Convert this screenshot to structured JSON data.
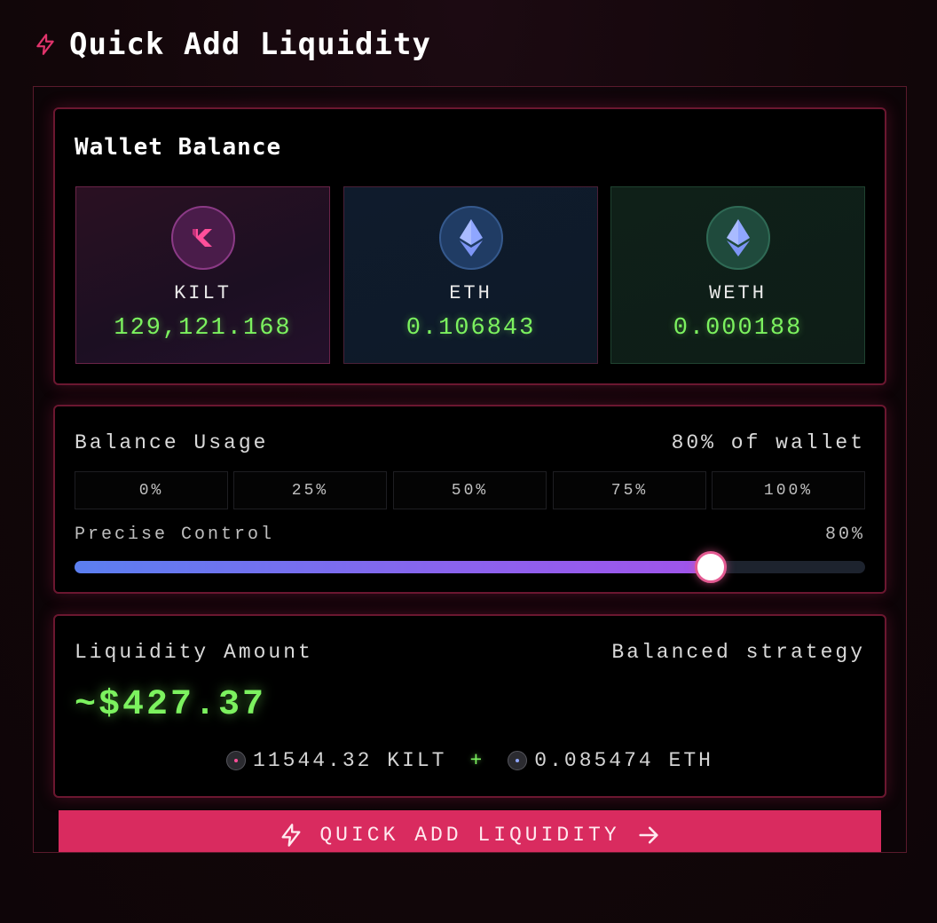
{
  "header": {
    "title": "Quick Add Liquidity",
    "icon": "lightning-icon"
  },
  "wallet": {
    "title": "Wallet Balance",
    "tokens": [
      {
        "symbol": "KILT",
        "balance": "129,121.168",
        "icon": "kilt-logo-icon"
      },
      {
        "symbol": "ETH",
        "balance": "0.106843",
        "icon": "ethereum-icon"
      },
      {
        "symbol": "WETH",
        "balance": "0.000188",
        "icon": "ethereum-icon"
      }
    ]
  },
  "usage": {
    "label": "Balance Usage",
    "summary": "80% of wallet",
    "buttons": [
      "0%",
      "25%",
      "50%",
      "75%",
      "100%"
    ],
    "precise_label": "Precise Control",
    "precise_value": "80%",
    "slider_fraction": 0.8,
    "slider_colors": {
      "start": "#5b7ff0",
      "end": "#a054ea",
      "thumb_border": "#e45a92"
    }
  },
  "liquidity": {
    "label": "Liquidity Amount",
    "strategy": "Balanced strategy",
    "amount": "~$427.37",
    "kilt_part": "11544.32 KILT",
    "plus": "+",
    "eth_part": "0.085474 ETH"
  },
  "cta": {
    "label": "QUICK ADD LIQUIDITY",
    "color": "#d92b5f"
  },
  "colors": {
    "accent": "#d92b5f",
    "value_green": "#7cf25f"
  }
}
